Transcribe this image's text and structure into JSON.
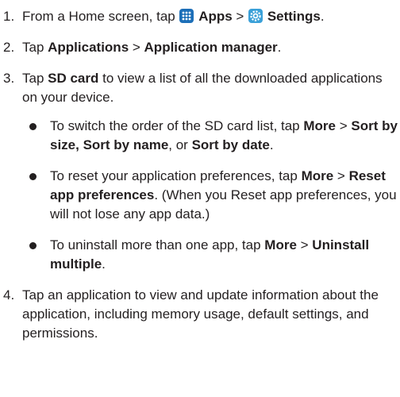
{
  "steps": [
    {
      "number": "1.",
      "parts": [
        "From a Home screen, tap ",
        " ",
        "Apps",
        " > ",
        " ",
        "Settings",
        "."
      ],
      "icons": [
        "apps-grid-icon",
        "settings-gear-icon"
      ]
    },
    {
      "number": "2.",
      "parts": [
        "Tap ",
        "Applications",
        " > ",
        "Application manager",
        "."
      ]
    },
    {
      "number": "3.",
      "parts": [
        "Tap ",
        "SD card",
        " to view a list of all the downloaded applications on your device."
      ],
      "bullets": [
        {
          "parts": [
            "To switch the order of the SD card list, tap ",
            "More",
            " > ",
            "Sort by size, Sort by name",
            ", or ",
            "Sort by date",
            "."
          ]
        },
        {
          "parts": [
            "To reset your application preferences, tap ",
            "More",
            " > ",
            "Reset app preferences",
            ". (When you Reset app preferences, you will not lose any app data.)"
          ]
        },
        {
          "parts": [
            "To uninstall more than one app, tap ",
            "More",
            " > ",
            "Uninstall multiple",
            "."
          ]
        }
      ]
    },
    {
      "number": "4.",
      "parts": [
        "Tap an application to view and update information about the application, including memory usage, default settings, and permissions."
      ]
    }
  ],
  "colors": {
    "text": "#231f20",
    "apps_icon_bg": "#1d6fb8",
    "settings_icon_bg": "#3aa0d8"
  }
}
